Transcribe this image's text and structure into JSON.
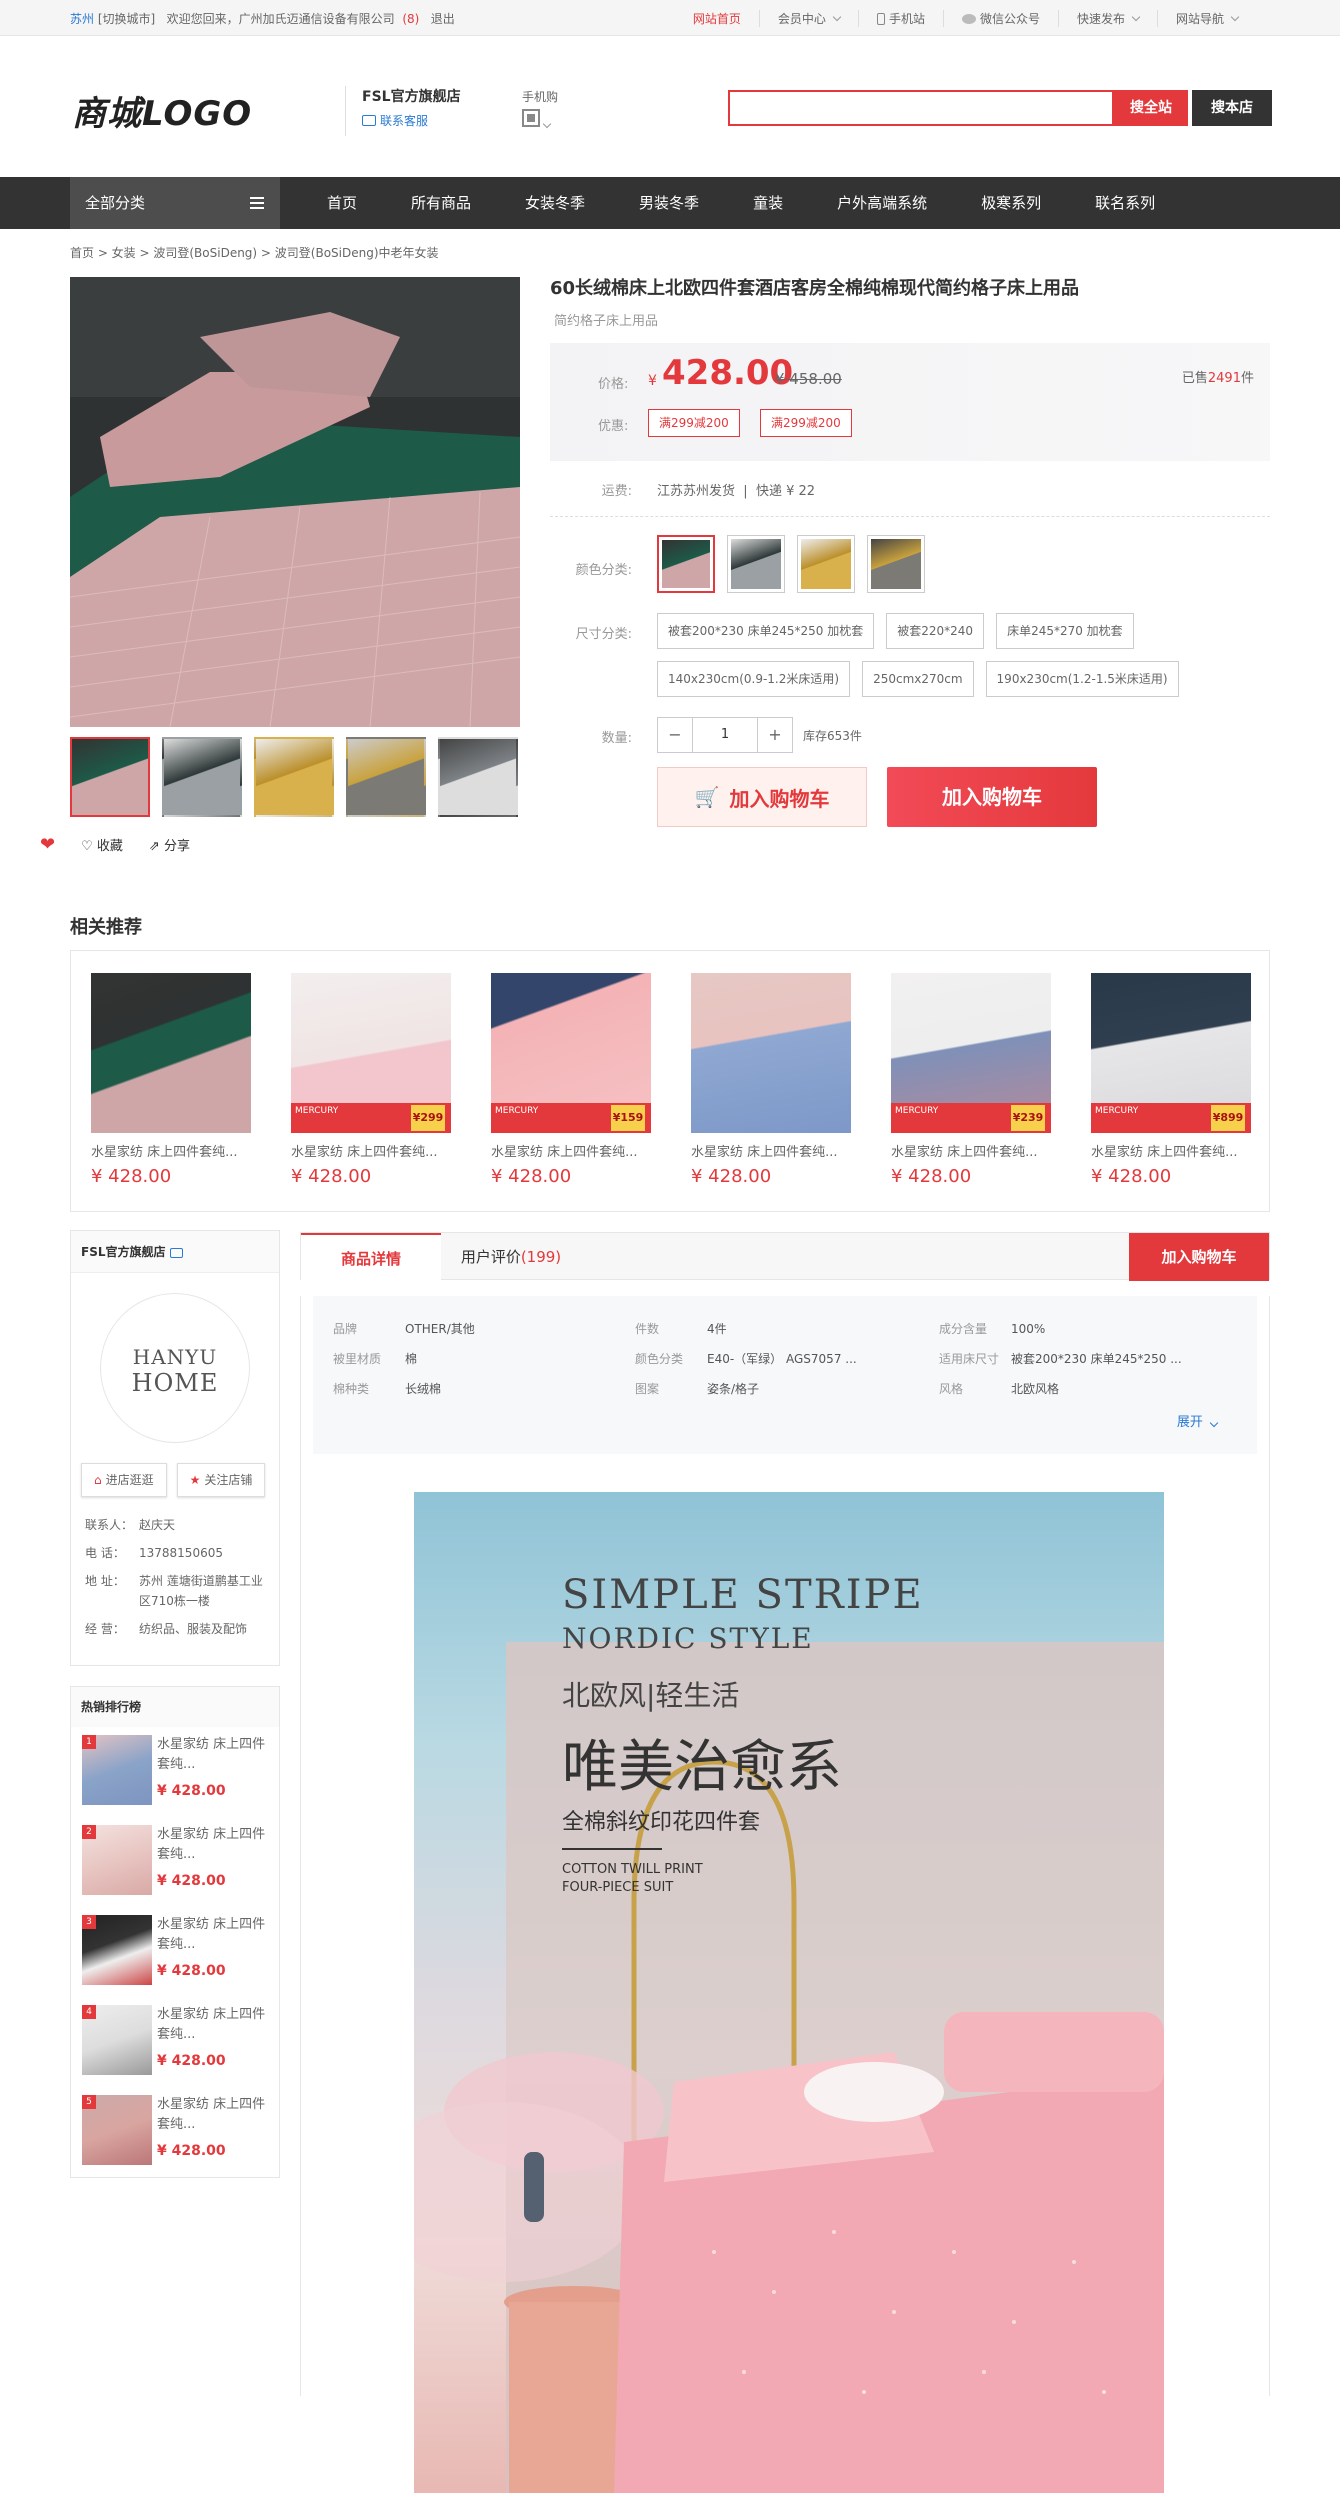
{
  "topbar": {
    "city": "苏州",
    "switch_city": "[切换城市]",
    "welcome": "欢迎您回来，广州加氏迈通信设备有限公司",
    "count": "(8)",
    "logout": "退出",
    "home": "网站首页",
    "member": "会员中心",
    "mobile": "手机站",
    "wechat": "微信公众号",
    "publish": "快速发布",
    "sitenav": "网站导航"
  },
  "header": {
    "logo": "商城LOGO",
    "shop_name": "FSL官方旗舰店",
    "service": "联系客服",
    "mobile_buy": "手机购",
    "search_all": "搜全站",
    "search_shop": "搜本店",
    "search_placeholder": ""
  },
  "nav": {
    "all": "全部分类",
    "items": [
      "首页",
      "所有商品",
      "女装冬季",
      "男装冬季",
      "童装",
      "户外高端系统",
      "极寒系列",
      "联名系列"
    ]
  },
  "breadcrumb": "首页 > 女装 > 波司登(BoSiDeng) > 波司登(BoSiDeng)中老年女装",
  "product": {
    "title": "60长绒棉床上北欧四件套酒店客房全棉纯棉现代简约格子床上用品",
    "subtitle": "简约格子床上用品",
    "price_label": "价格:",
    "currency": "¥",
    "price": "428.00",
    "old_price": "¥ 458.00",
    "sold_prefix": "已售",
    "sold_count": "2491",
    "sold_suffix": "件",
    "promo_label": "优惠:",
    "coupons": [
      "满299减200",
      "满299减200"
    ],
    "ship_label": "运费:",
    "ship_from": "江苏苏州发货",
    "ship_fee": "快递 ¥ 22",
    "color_label": "颜色分类:",
    "size_label": "尺寸分类:",
    "sizes": [
      "被套200*230 床单245*250 加枕套",
      "被套220*240",
      "床单245*270 加枕套",
      "140x230cm(0.9-1.2米床适用)",
      "250cmx270cm",
      "190x230cm(1.2-1.5米床适用)"
    ],
    "qty_label": "数量:",
    "qty": "1",
    "minus": "−",
    "plus": "+",
    "stock": "库存653件",
    "cart_btn1": "加入购物车",
    "cart_btn2": "加入购物车",
    "favorite": "收藏",
    "share": "分享"
  },
  "related": {
    "title": "相关推荐",
    "items": [
      {
        "title": "水星家纺 床上四件套纯...",
        "price": "¥ 428.00"
      },
      {
        "title": "水星家纺 床上四件套纯...",
        "price": "¥ 428.00",
        "badge_price": "¥299"
      },
      {
        "title": "水星家纺 床上四件套纯...",
        "price": "¥ 428.00",
        "badge_price": "¥159"
      },
      {
        "title": "水星家纺 床上四件套纯...",
        "price": "¥ 428.00"
      },
      {
        "title": "水星家纺 床上四件套纯...",
        "price": "¥ 428.00",
        "badge_price": "¥239"
      },
      {
        "title": "水星家纺 床上四件套纯...",
        "price": "¥ 428.00",
        "badge_price": "¥899"
      }
    ]
  },
  "shop": {
    "name": "FSL官方旗舰店",
    "logo_line1": "HANYU",
    "logo_line2": "HOME",
    "enter": "进店逛逛",
    "follow": "关注店铺",
    "contact_label": "联系人：",
    "contact": "赵庆天",
    "phone_label": "电    话：",
    "phone": "13788150605",
    "addr_label": "地    址：",
    "addr": "苏州 莲塘街道鹏基工业区710栋一楼",
    "biz_label": "经    营：",
    "biz": "纺织品、服装及配饰"
  },
  "hot": {
    "title": "热销排行榜",
    "items": [
      {
        "num": "1",
        "title": "水星家纺 床上四件套纯...",
        "price": "¥ 428.00"
      },
      {
        "num": "2",
        "title": "水星家纺 床上四件套纯...",
        "price": "¥ 428.00"
      },
      {
        "num": "3",
        "title": "水星家纺 床上四件套纯...",
        "price": "¥ 428.00"
      },
      {
        "num": "4",
        "title": "水星家纺 床上四件套纯...",
        "price": "¥ 428.00"
      },
      {
        "num": "5",
        "title": "水星家纺 床上四件套纯...",
        "price": "¥ 428.00"
      }
    ]
  },
  "tabs": {
    "detail": "商品详情",
    "reviews": "用户评价",
    "review_count": "(199)",
    "add_cart": "加入购物车"
  },
  "params": [
    {
      "k": "品牌",
      "v": "OTHER/其他"
    },
    {
      "k": "件数",
      "v": "4件"
    },
    {
      "k": "成分含量",
      "v": "100%"
    },
    {
      "k": "被里材质",
      "v": "棉"
    },
    {
      "k": "颜色分类",
      "v": "E40-（军绿）   AGS7057 ..."
    },
    {
      "k": "适用床尺寸",
      "v": "被套200*230 床单245*250 ..."
    },
    {
      "k": "棉种类",
      "v": "长绒棉"
    },
    {
      "k": "图案",
      "v": "姿条/格子"
    },
    {
      "k": "风格",
      "v": "北欧风格"
    }
  ],
  "params_more": "展开",
  "banner": {
    "line1": "SIMPLE STRIPE",
    "line2": "NORDIC STYLE",
    "line3": "北欧风|轻生活",
    "line4": "唯美治愈系",
    "line5": "全棉斜纹印花四件套",
    "line6": "COTTON TWILL PRINT",
    "line7": "FOUR-PIECE SUIT"
  },
  "colors": {
    "accent": "#e4393c",
    "nav_bg": "#333333",
    "link": "#2a7ad3"
  }
}
